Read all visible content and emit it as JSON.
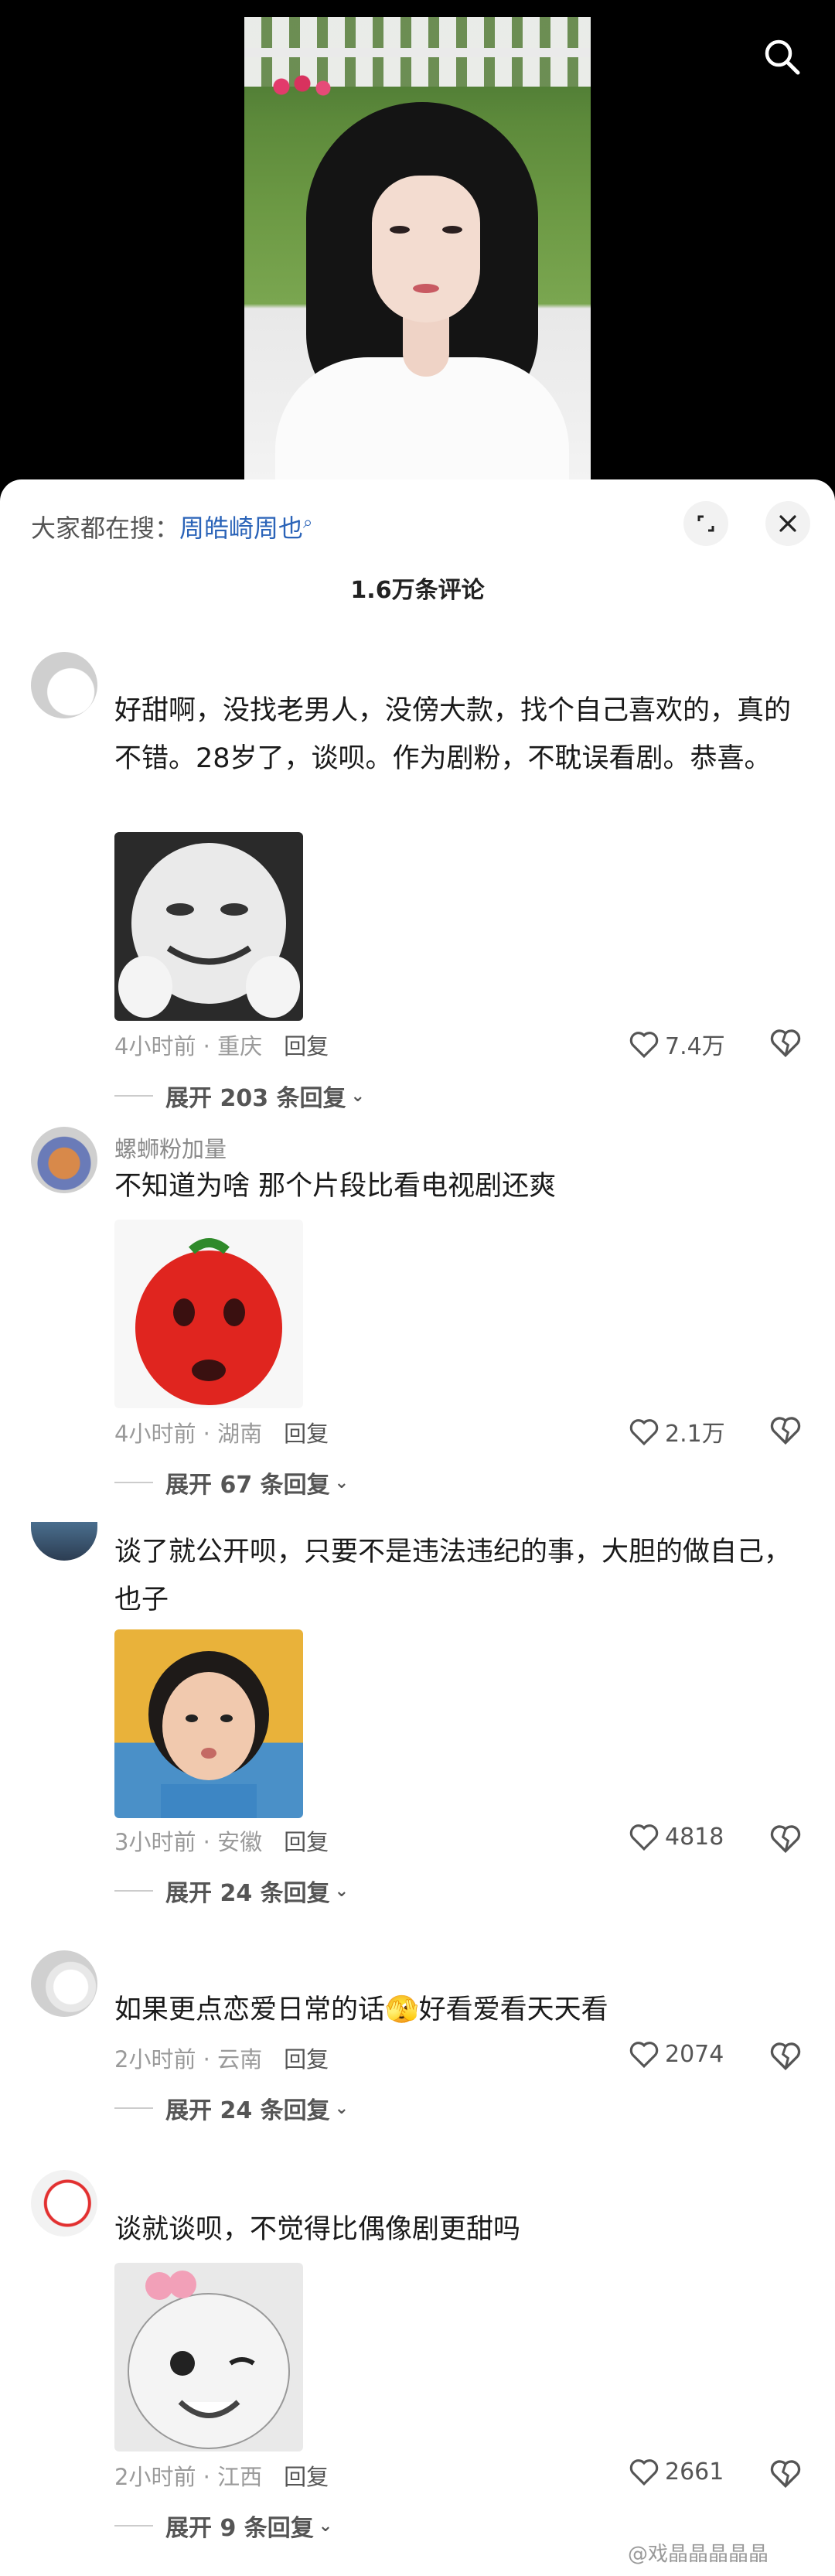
{
  "video": {
    "search_icon": "search-icon"
  },
  "header": {
    "search_prefix": "大家都在搜：",
    "search_keyword": "周皓崎周也",
    "search_suffix_icon": "magnifier-icon",
    "expand_icon": "expand-icon",
    "close_icon": "close-icon",
    "comment_count_title": "1.6万条评论"
  },
  "comments": [
    {
      "username": "",
      "text": "好甜啊，没找老男人，没傍大款，找个自己喜欢的，真的不错。28岁了，谈呗。作为剧粉，不耽误看剧。恭喜。",
      "sticker": "meme-face-sticker",
      "time_location": "4小时前 · 重庆",
      "reply_label": "回复",
      "likes": "7.4万",
      "expand_label": "展开 203 条回复"
    },
    {
      "username": "螺蛳粉加量",
      "text": "不知道为啥 那个片段比看电视剧还爽",
      "sticker": "tomato-face-sticker",
      "time_location": "4小时前 · 湖南",
      "reply_label": "回复",
      "likes": "2.1万",
      "expand_label": "展开 67 条回复"
    },
    {
      "username": "",
      "text": "谈了就公开呗，只要不是违法违纪的事，大胆的做自己，也子",
      "sticker": "girl-pout-sticker",
      "time_location": "3小时前 · 安徽",
      "reply_label": "回复",
      "likes": "4818",
      "expand_label": "展开 24 条回复"
    },
    {
      "username": "",
      "text": "如果更点恋爱日常的话🫣好看爱看天天看",
      "sticker": "",
      "time_location": "2小时前 · 云南",
      "reply_label": "回复",
      "likes": "2074",
      "expand_label": "展开 24 条回复"
    },
    {
      "username": "",
      "text": "谈就谈呗，不觉得比偶像剧更甜吗",
      "sticker": "baby-wink-sticker",
      "time_location": "2小时前 · 江西",
      "reply_label": "回复",
      "likes": "2661",
      "expand_label": "展开 9 条回复"
    }
  ],
  "watermark": "@戏晶晶晶晶晶",
  "colors": {
    "link": "#2a63b8",
    "muted": "#9a9a9a",
    "sheet": "#ffffff",
    "background": "#000000"
  }
}
